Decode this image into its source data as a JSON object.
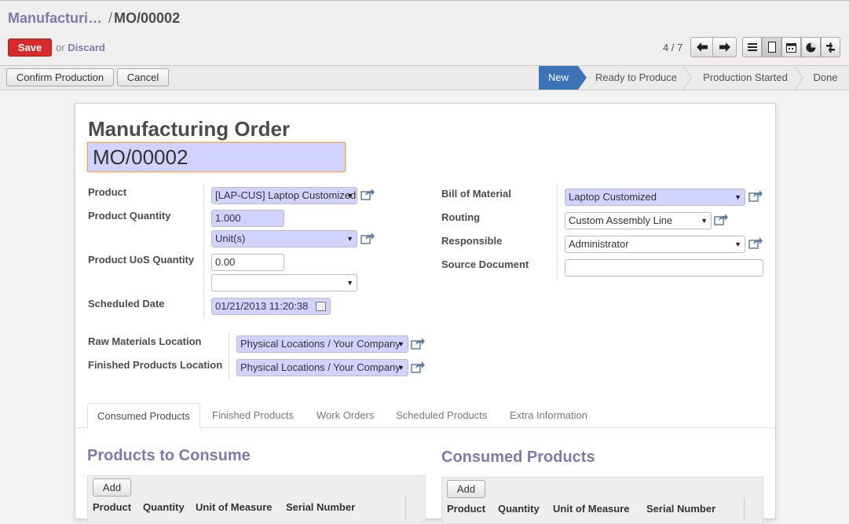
{
  "header": {
    "breadcrumb_parent": "Manufacturi…",
    "breadcrumb_sep": "/",
    "breadcrumb_current": "MO/00002",
    "save_label": "Save",
    "or_text": "or",
    "discard_label": "Discard",
    "pager_text": "4 / 7"
  },
  "statusbar": {
    "confirm_label": "Confirm Production",
    "cancel_label": "Cancel",
    "stages": [
      "New",
      "Ready to Produce",
      "Production Started",
      "Done"
    ],
    "active_stage": "New"
  },
  "form": {
    "title": "Manufacturing Order",
    "name": "MO/00002",
    "left": {
      "product_label": "Product",
      "product_value": "[LAP-CUS] Laptop Customized",
      "qty_label": "Product Quantity",
      "qty_value": "1.000",
      "uom_value": "Unit(s)",
      "uos_qty_label": "Product UoS Quantity",
      "uos_qty_value": "0.00",
      "uos_value": "",
      "date_label": "Scheduled Date",
      "date_value": "01/21/2013 11:20:38"
    },
    "right": {
      "bom_label": "Bill of Material",
      "bom_value": "Laptop Customized",
      "routing_label": "Routing",
      "routing_value": "Custom Assembly Line",
      "responsible_label": "Responsible",
      "responsible_value": "Administrator",
      "source_label": "Source Document",
      "source_value": ""
    },
    "locations": {
      "raw_label": "Raw Materials Location",
      "raw_value": "Physical Locations / Your Company",
      "finished_label": "Finished Products Location",
      "finished_value": "Physical Locations / Your Company"
    }
  },
  "tabs": [
    "Consumed Products",
    "Finished Products",
    "Work Orders",
    "Scheduled Products",
    "Extra Information"
  ],
  "consume": {
    "left_title": "Products to Consume",
    "right_title": "Consumed Products",
    "add_label": "Add",
    "left_columns": [
      "Product",
      "Quantity",
      "Unit of Measure",
      "Serial Number"
    ],
    "right_columns": [
      "Product",
      "Quantity",
      "Unit of Measure",
      "Serial Number"
    ]
  },
  "colors": {
    "accent": "#7c7bad",
    "save": "#d62b2b",
    "active_stage": "#3c73b8",
    "required": "#d2d2ff"
  }
}
